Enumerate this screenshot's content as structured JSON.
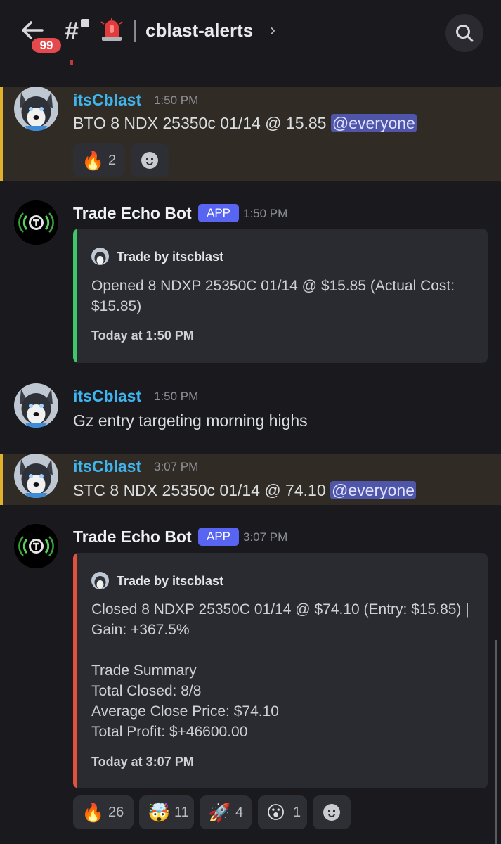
{
  "header": {
    "unread_count": "99",
    "channel_name": "cblast-alerts",
    "separator": "|"
  },
  "messages": [
    {
      "author": "itsCblast",
      "time": "1:50 PM",
      "text": "BTO 8 NDX 25350c 01/14 @ 15.85",
      "mention": "@everyone",
      "reactions": [
        {
          "emoji": "🔥",
          "count": "2"
        }
      ]
    },
    {
      "author": "Trade Echo Bot",
      "tag": "APP",
      "time": "1:50 PM",
      "embed": {
        "author": "Trade by itscblast",
        "lines": [
          "Opened 8 NDXP 25350C 01/14 @ $15.85 (Actual Cost:",
          "$15.85)"
        ],
        "footer": "Today at 1:50 PM",
        "accent": "#3ec76a"
      }
    },
    {
      "author": "itsCblast",
      "time": "1:50 PM",
      "text": "Gz entry targeting morning highs"
    },
    {
      "author": "itsCblast",
      "time": "3:07 PM",
      "text": "STC 8 NDX 25350c 01/14 @ 74.10",
      "mention": "@everyone"
    },
    {
      "author": "Trade Echo Bot",
      "tag": "APP",
      "time": "3:07 PM",
      "embed": {
        "author": "Trade by itscblast",
        "lines": [
          "Closed 8 NDXP 25350C 01/14 @ $74.10 (Entry: $15.85) |",
          "Gain: +367.5%",
          "",
          "Trade Summary",
          "Total Closed: 8/8",
          "Average Close Price: $74.10",
          "Total Profit: $+46600.00"
        ],
        "footer": "Today at 3:07 PM",
        "accent": "#e0523d"
      },
      "reactions": [
        {
          "emoji": "🔥",
          "count": "26"
        },
        {
          "emoji": "🤯",
          "count": "11"
        },
        {
          "emoji": "🚀",
          "count": "4"
        },
        {
          "emoji": "😮",
          "count": "1"
        }
      ]
    }
  ],
  "icons": [
    "back-arrow-icon",
    "hashtag-lock-icon",
    "siren-icon",
    "chevron-right-icon",
    "search-icon",
    "add-reaction-icon"
  ],
  "colors": {
    "highlight_bg": "#302c25",
    "highlight_bar": "#e1b12c",
    "username_blue": "#3fb4ee",
    "mention_bg": "#4f55a8",
    "app_tag": "#5865f2"
  }
}
